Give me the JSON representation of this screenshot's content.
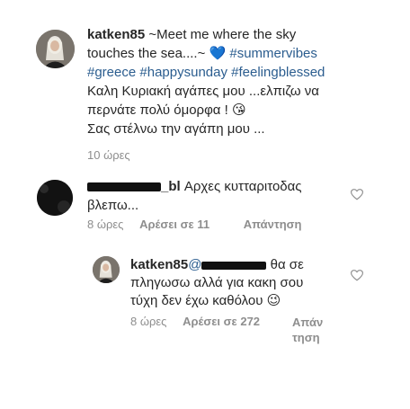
{
  "post": {
    "username": "katken85",
    "caption_line1": "~Meet me where the sky",
    "caption_line2": "touches the sea....~",
    "heart_emoji": "💙",
    "hashtag_summervibes": "#summervibes",
    "hashtags_line": [
      "#greece",
      "#happysunday",
      "#feelingblessed"
    ],
    "greek_line1": "Καλη Κυριακή αγάπες μου ...ελπιζω να",
    "greek_line2": "περνάτε πολύ όμορφα !",
    "kiss_emoji": "😘",
    "greek_line3": "Σας στέλνω την αγάπη μου ...",
    "time": "10 ώρες"
  },
  "comment1": {
    "username_tail": "_bl",
    "text_line1": "Αρχες κυτταριτοδας",
    "text_line2": "βλεπω...",
    "time": "8 ώρες",
    "likes": "Αρέσει σε 11",
    "reply": "Απάντηση"
  },
  "comment2": {
    "username": "katken85",
    "mention_prefix": "@",
    "text_line1": "θα σε",
    "text_line2": "πληγωσω αλλά για κακη σου",
    "text_line3": "τύχη δεν έχω καθόλου",
    "wink_emoji": "😉",
    "time": "8 ώρες",
    "likes": "Αρέσει σε 272",
    "reply_line1": "Απάν",
    "reply_line2": "τηση"
  },
  "colors": {
    "hashtag": "#2b5d8f",
    "secondary": "#8e8e8e",
    "text": "#262626"
  },
  "icons": [
    "heart-outline-icon"
  ]
}
